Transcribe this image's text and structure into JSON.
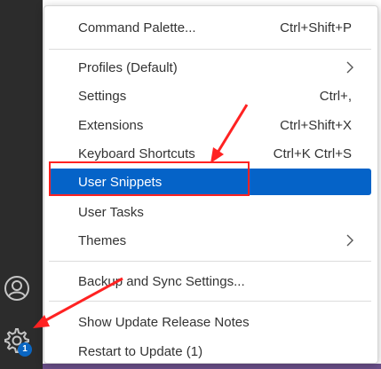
{
  "activity_bar": {
    "account_icon": "account-icon",
    "manage_icon": "gear-icon",
    "badge_count": "1"
  },
  "menu": {
    "items": [
      {
        "label": "Command Palette...",
        "shortcut": "Ctrl+Shift+P"
      },
      {
        "label": "Profiles (Default)",
        "shortcut": "",
        "submenu": true
      },
      {
        "label": "Settings",
        "shortcut": "Ctrl+,"
      },
      {
        "label": "Extensions",
        "shortcut": "Ctrl+Shift+X"
      },
      {
        "label": "Keyboard Shortcuts",
        "shortcut": "Ctrl+K Ctrl+S"
      },
      {
        "label": "User Snippets",
        "shortcut": "",
        "selected": true
      },
      {
        "label": "User Tasks",
        "shortcut": ""
      },
      {
        "label": "Themes",
        "shortcut": "",
        "submenu": true
      },
      {
        "label": "Backup and Sync Settings...",
        "shortcut": ""
      },
      {
        "label": "Show Update Release Notes",
        "shortcut": ""
      },
      {
        "label": "Restart to Update (1)",
        "shortcut": ""
      }
    ]
  },
  "colors": {
    "selected_bg": "#0563c8",
    "annotation": "#ff2222",
    "activity_bar": "#2c2c2c"
  }
}
